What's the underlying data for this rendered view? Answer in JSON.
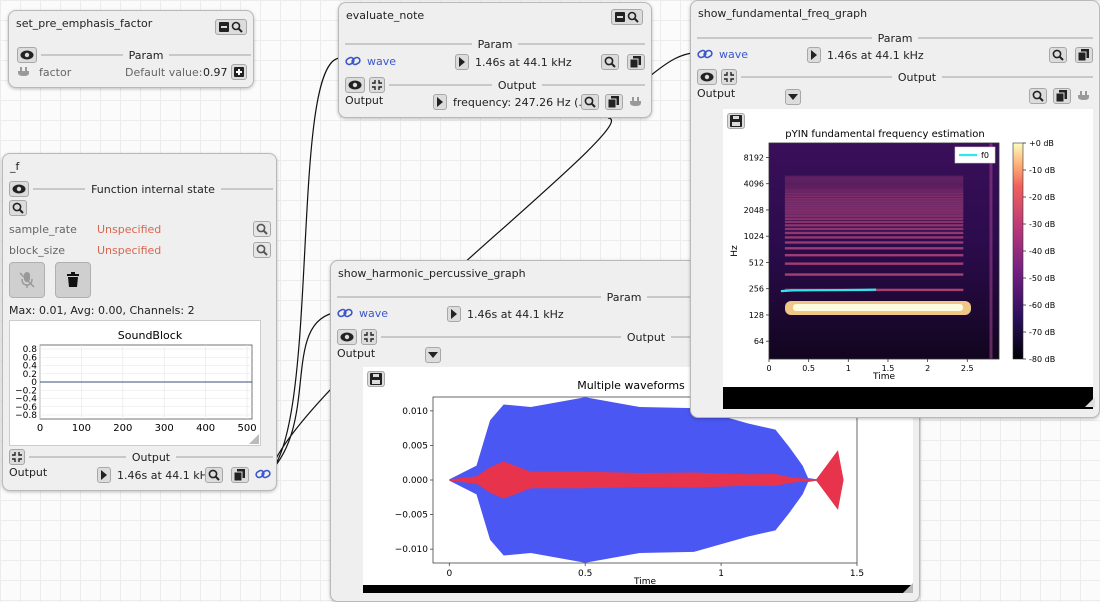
{
  "nodes": {
    "pre_emphasis": {
      "title": "set_pre_emphasis_factor",
      "param_label": "Param",
      "param_name": "factor",
      "default_label": "Default value:",
      "default_value": "0.97"
    },
    "evaluate": {
      "title": "evaluate_note",
      "param_label": "Param",
      "wave_label": "wave",
      "wave_value": "1.46s at 44.1 kHz",
      "output_label": "Output",
      "output_small": "Output",
      "output_value": "frequency: 247.26 Hz (...)"
    },
    "f": {
      "title": "_f",
      "section_label": "Function internal state",
      "rows": [
        {
          "name": "sample_rate",
          "value": "Unspecified"
        },
        {
          "name": "block_size",
          "value": "Unspecified"
        }
      ],
      "stats": "Max: 0.01, Avg: 0.00, Channels: 2",
      "output_label": "Output",
      "output_small": "Output",
      "output_value": "1.46s at 44.1 kHz"
    },
    "harmonic": {
      "title": "show_harmonic_percussive_graph",
      "param_label": "Param",
      "wave_label": "wave",
      "wave_value": "1.46s at 44.1 kHz",
      "output_label": "Output",
      "output_small": "Output"
    },
    "fundamental": {
      "title": "show_fundamental_freq_graph",
      "param_label": "Param",
      "wave_label": "wave",
      "wave_value": "1.46s at 44.1 kHz",
      "output_label": "Output",
      "output_small": "Output"
    }
  },
  "charts": {
    "soundblock": {
      "title": "SoundBlock",
      "yticks": [
        "0.8",
        "0.6",
        "0.4",
        "0.2",
        "0",
        "−0.2",
        "−0.4",
        "−0.6",
        "−0.8"
      ],
      "xticks": [
        "0",
        "100",
        "200",
        "300",
        "400",
        "500"
      ]
    },
    "waveforms": {
      "title": "Multiple waveforms",
      "xlabel": "Time",
      "yticks": [
        "0.010",
        "0.005",
        "0.000",
        "−0.005",
        "−0.010"
      ],
      "xticks": [
        "0",
        "0.5",
        "1",
        "1.5"
      ]
    },
    "pyin": {
      "title": "pYIN fundamental frequency estimation",
      "xlabel": "Time",
      "ylabel": "Hz",
      "yticks": [
        "8192",
        "4096",
        "2048",
        "1024",
        "512",
        "256",
        "128",
        "64"
      ],
      "xticks": [
        "0",
        "0.5",
        "1",
        "1.5",
        "2",
        "2.5"
      ],
      "legend": "f0",
      "cbar_ticks": [
        "+0 dB",
        "-10 dB",
        "-20 dB",
        "-30 dB",
        "-40 dB",
        "-50 dB",
        "-60 dB",
        "-70 dB",
        "-80 dB"
      ]
    }
  },
  "chart_data": [
    {
      "type": "line",
      "title": "SoundBlock",
      "xlim": [
        0,
        512
      ],
      "ylim": [
        -0.9,
        0.9
      ],
      "series": [
        {
          "x": [
            0,
            512
          ],
          "values": [
            0,
            0
          ]
        }
      ]
    },
    {
      "type": "area",
      "title": "Multiple waveforms",
      "xlabel": "Time",
      "xlim": [
        -0.06,
        1.5
      ],
      "ylim": [
        -0.012,
        0.012
      ],
      "series": [
        {
          "color": "#4b57f2",
          "x": [
            0,
            0.1,
            0.15,
            0.2,
            0.3,
            0.5,
            0.7,
            0.9,
            1.1,
            1.2,
            1.25,
            1.3,
            1.32,
            1.35,
            1.43,
            1.45
          ],
          "values": [
            0.0001,
            0.002,
            0.009,
            0.0105,
            0.011,
            0.0115,
            0.011,
            0.01,
            0.0085,
            0.007,
            0.005,
            0.002,
            0.0003,
            0.0001,
            0.004,
            0.0001
          ]
        },
        {
          "color": "#e8334d",
          "x": [
            0,
            0.1,
            0.15,
            0.2,
            0.3,
            0.5,
            0.7,
            0.9,
            1.1,
            1.2,
            1.25,
            1.3,
            1.35,
            1.43,
            1.45
          ],
          "values": [
            0.0001,
            0.0005,
            0.002,
            0.0025,
            0.0013,
            0.0011,
            0.0011,
            0.001,
            0.0009,
            0.0008,
            0.0005,
            0.0002,
            0.0001,
            0.004,
            0.0001
          ]
        }
      ]
    },
    {
      "type": "heatmap",
      "title": "pYIN fundamental frequency estimation",
      "xlabel": "Time",
      "ylabel": "Hz",
      "xlim": [
        0,
        2.9
      ],
      "series": [
        {
          "name": "f0",
          "color": "#2ee6ee",
          "x": [
            0.15,
            0.3,
            0.6,
            0.9,
            1.2,
            1.35
          ],
          "values": [
            240,
            245,
            246,
            247,
            248,
            250
          ]
        }
      ],
      "color_range_db": [
        -80,
        0
      ]
    }
  ]
}
